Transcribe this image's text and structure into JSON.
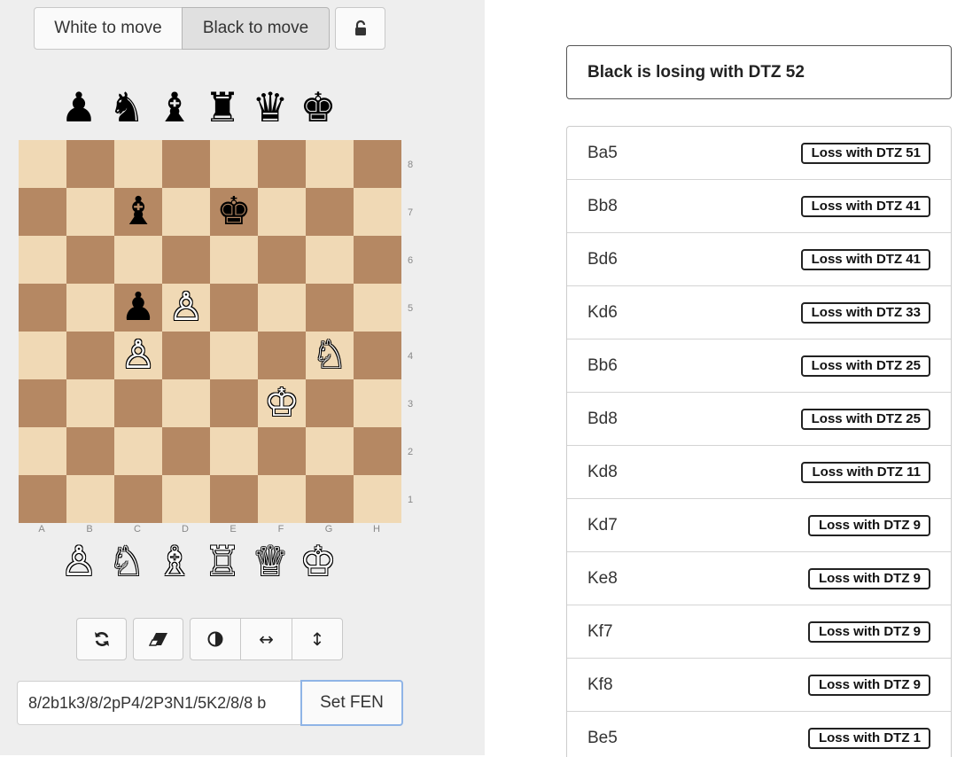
{
  "turn_buttons": {
    "white": "White to move",
    "black": "Black to move",
    "lock_icon": "lock-open-icon"
  },
  "spares": {
    "black": [
      "♟",
      "♞",
      "♝",
      "♜",
      "♛",
      "♚"
    ],
    "white": [
      "♙",
      "♘",
      "♗",
      "♖",
      "♕",
      "♔"
    ]
  },
  "board": {
    "ranks": [
      "8",
      "7",
      "6",
      "5",
      "4",
      "3",
      "2",
      "1"
    ],
    "files": [
      "A",
      "B",
      "C",
      "D",
      "E",
      "F",
      "G",
      "H"
    ],
    "colors": {
      "light": "#f0d9b5",
      "dark": "#b58863"
    },
    "pieces": [
      {
        "square": "c7",
        "glyph": "♝",
        "side": "black"
      },
      {
        "square": "e7",
        "glyph": "♚",
        "side": "black"
      },
      {
        "square": "c5",
        "glyph": "♟",
        "side": "black"
      },
      {
        "square": "d5",
        "glyph": "♙",
        "side": "white"
      },
      {
        "square": "c4",
        "glyph": "♙",
        "side": "white"
      },
      {
        "square": "g4",
        "glyph": "♘",
        "side": "white"
      },
      {
        "square": "f3",
        "glyph": "♔",
        "side": "white"
      }
    ]
  },
  "tools": {
    "flip": "⟳",
    "clear": "⌫",
    "color": "◑",
    "mirror_h": "↔",
    "mirror_v": "↕"
  },
  "fen": {
    "value": "8/2b1k3/8/2pP4/2P3N1/5K2/8/8 b",
    "button": "Set FEN"
  },
  "status": "Black is losing with DTZ 52",
  "moves": [
    {
      "move": "Ba5",
      "result": "Loss with DTZ 51"
    },
    {
      "move": "Bb8",
      "result": "Loss with DTZ 41"
    },
    {
      "move": "Bd6",
      "result": "Loss with DTZ 41"
    },
    {
      "move": "Kd6",
      "result": "Loss with DTZ 33"
    },
    {
      "move": "Bb6",
      "result": "Loss with DTZ 25"
    },
    {
      "move": "Bd8",
      "result": "Loss with DTZ 25"
    },
    {
      "move": "Kd8",
      "result": "Loss with DTZ 11"
    },
    {
      "move": "Kd7",
      "result": "Loss with DTZ 9"
    },
    {
      "move": "Ke8",
      "result": "Loss with DTZ 9"
    },
    {
      "move": "Kf7",
      "result": "Loss with DTZ 9"
    },
    {
      "move": "Kf8",
      "result": "Loss with DTZ 9"
    },
    {
      "move": "Be5",
      "result": "Loss with DTZ 1"
    }
  ]
}
